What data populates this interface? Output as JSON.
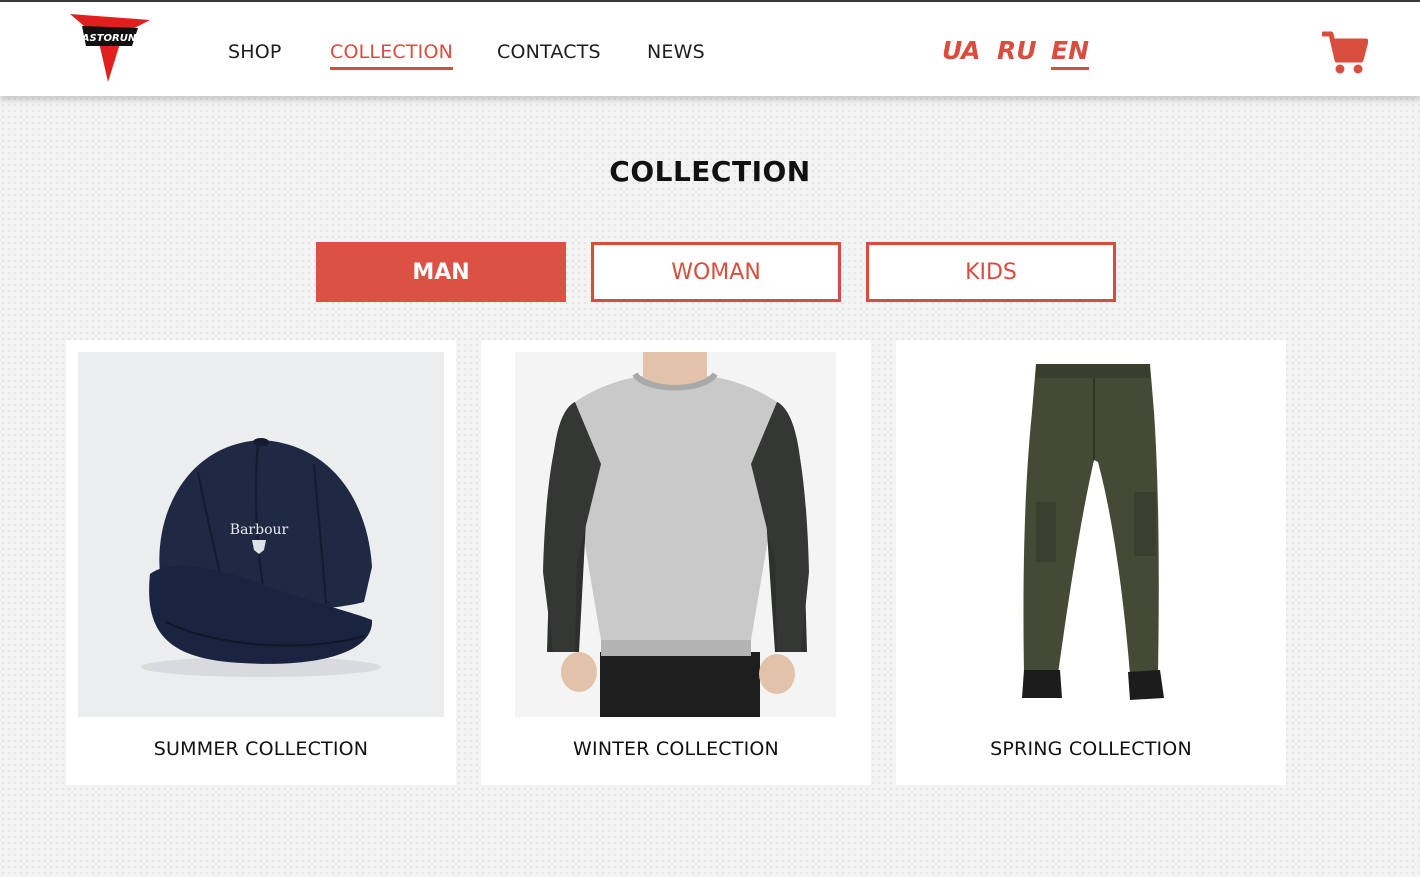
{
  "brand": {
    "logo_text": "ASTORUN"
  },
  "nav": [
    {
      "label": "SHOP",
      "active": false
    },
    {
      "label": "COLLECTION",
      "active": true
    },
    {
      "label": "CONTACTS",
      "active": false
    },
    {
      "label": "NEWS",
      "active": false
    }
  ],
  "languages": [
    {
      "label": "UA",
      "active": false
    },
    {
      "label": "RU",
      "active": false
    },
    {
      "label": "EN",
      "active": true
    }
  ],
  "cart": {
    "icon": "shopping-cart-icon"
  },
  "page": {
    "title": "COLLECTION"
  },
  "tabs": [
    {
      "label": "MAN",
      "active": true
    },
    {
      "label": "WOMAN",
      "active": false
    },
    {
      "label": "KIDS",
      "active": false
    }
  ],
  "collections": [
    {
      "label": "SUMMER COLLECTION",
      "image": "navy-baseball-cap",
      "cap_brand": "Barbour"
    },
    {
      "label": "WINTER COLLECTION",
      "image": "grey-raglan-sweatshirt"
    },
    {
      "label": "SPRING COLLECTION",
      "image": "olive-cargo-pants"
    }
  ],
  "colors": {
    "accent": "#d94d3f",
    "text": "#111111",
    "header_bg": "#ffffff"
  }
}
